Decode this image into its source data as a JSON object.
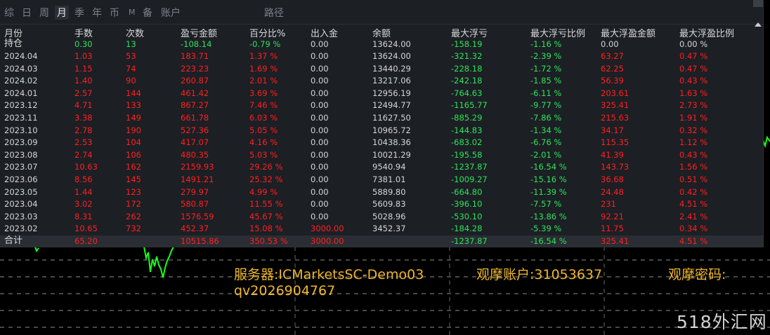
{
  "tabs": [
    "综",
    "日",
    "周",
    "月",
    "季",
    "年",
    "币",
    "M",
    "备",
    "账户",
    "路径"
  ],
  "active_tab": "月",
  "columns": [
    "月份",
    "手数",
    "次数",
    "盈亏金额",
    "百分比%",
    "出入金",
    "余额",
    "最大浮亏",
    "最大浮亏比例",
    "最大浮盈金额",
    "最大浮盈比例"
  ],
  "holding": [
    "持仓",
    "0.30",
    "13",
    "-108.14",
    "-0.79 %",
    "0.00",
    "13624.00",
    "-158.19",
    "-1.16 %",
    "0.00",
    "0.00 %"
  ],
  "rows": [
    [
      "2024.04",
      "1.03",
      "53",
      "183.71",
      "1.37 %",
      "0.00",
      "13624.00",
      "-321.32",
      "-2.39 %",
      "63.27",
      "0.47 %"
    ],
    [
      "2024.03",
      "1.15",
      "74",
      "223.23",
      "1.69 %",
      "0.00",
      "13440.29",
      "-228.18",
      "-1.72 %",
      "62.25",
      "0.47 %"
    ],
    [
      "2024.02",
      "1.40",
      "90",
      "260.87",
      "2.01 %",
      "0.00",
      "13217.06",
      "-242.18",
      "-1.85 %",
      "56.39",
      "0.43 %"
    ],
    [
      "2024.01",
      "2.57",
      "144",
      "461.42",
      "3.69 %",
      "0.00",
      "12956.19",
      "-764.63",
      "-6.11 %",
      "203.61",
      "1.63 %"
    ],
    [
      "2023.12",
      "4.71",
      "133",
      "867.27",
      "7.46 %",
      "0.00",
      "12494.77",
      "-1165.77",
      "-9.77 %",
      "325.41",
      "2.73 %"
    ],
    [
      "2023.11",
      "3.38",
      "149",
      "661.78",
      "6.03 %",
      "0.00",
      "11627.50",
      "-885.29",
      "-7.86 %",
      "215.63",
      "1.91 %"
    ],
    [
      "2023.10",
      "2.78",
      "190",
      "527.36",
      "5.05 %",
      "0.00",
      "10965.72",
      "-144.83",
      "-1.34 %",
      "34.17",
      "0.32 %"
    ],
    [
      "2023.09",
      "2.53",
      "104",
      "417.07",
      "4.16 %",
      "0.00",
      "10438.36",
      "-683.02",
      "-6.76 %",
      "115.35",
      "1.12 %"
    ],
    [
      "2023.08",
      "2.74",
      "106",
      "480.35",
      "5.03 %",
      "0.00",
      "10021.29",
      "-195.58",
      "-2.01 %",
      "41.39",
      "0.43 %"
    ],
    [
      "2023.07",
      "10.63",
      "162",
      "2159.93",
      "29.26 %",
      "0.00",
      "9540.94",
      "-1237.87",
      "-16.54 %",
      "143.73",
      "1.56 %"
    ],
    [
      "2023.06",
      "8.56",
      "145",
      "1491.21",
      "25.32 %",
      "0.00",
      "7381.01",
      "-1009.27",
      "-15.16 %",
      "36.68",
      "0.51 %"
    ],
    [
      "2023.05",
      "1.44",
      "123",
      "279.97",
      "4.99 %",
      "0.00",
      "5889.80",
      "-664.80",
      "-11.39 %",
      "24.48",
      "0.42 %"
    ],
    [
      "2023.04",
      "3.02",
      "172",
      "580.87",
      "11.55 %",
      "0.00",
      "5609.83",
      "-396.10",
      "-7.57 %",
      "231",
      "4.51 %"
    ],
    [
      "2023.03",
      "8.31",
      "262",
      "1576.59",
      "45.67 %",
      "0.00",
      "5028.96",
      "-530.10",
      "-13.86 %",
      "92.21",
      "2.41 %"
    ],
    [
      "2023.02",
      "10.65",
      "732",
      "452.37",
      "15.08 %",
      "3000.00",
      "3452.37",
      "-184.28",
      "-5.39 %",
      "11.75",
      "0.34 %"
    ]
  ],
  "total": [
    "合计",
    "65.20",
    "",
    "10515.86",
    "350.53 %",
    "3000.00",
    "",
    "-1237.87",
    "-16.54 %",
    "325.41",
    "4.51 %"
  ],
  "overlay": {
    "server": "服务器:ICMarketsSC-Demo03",
    "account": "观摩账户:31053637",
    "password_label": "观摩密码:",
    "password": "qv2026904767"
  },
  "watermark": "518外汇网",
  "colors": {
    "red": "#ff2020",
    "green": "#2ee35c",
    "text": "#d6d6d6",
    "gold": "#f0b82a",
    "chart_line": "#1aff1a"
  }
}
